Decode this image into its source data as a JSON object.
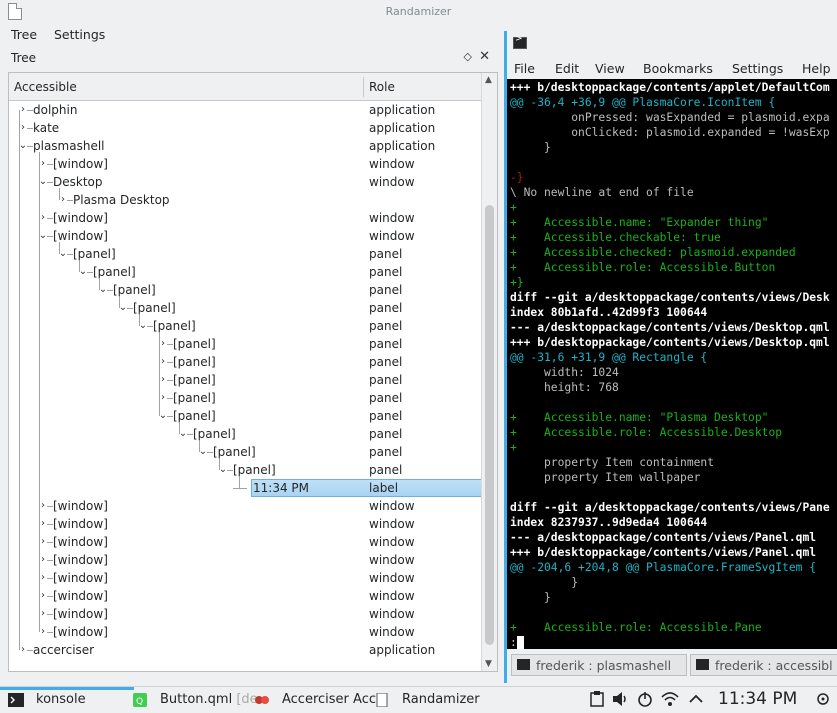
{
  "window": {
    "title": "Randamizer"
  },
  "menu": {
    "tree": "Tree",
    "settings": "Settings"
  },
  "dock": {
    "title": "Tree",
    "float_glyph": "◇",
    "close_glyph": "✕"
  },
  "tree": {
    "columns": {
      "accessible": "Accessible",
      "role": "Role"
    },
    "rows": [
      {
        "name": "dolphin",
        "role": "application",
        "depth": 0,
        "exp": "closed"
      },
      {
        "name": "kate",
        "role": "application",
        "depth": 0,
        "exp": "closed"
      },
      {
        "name": "plasmashell",
        "role": "application",
        "depth": 0,
        "exp": "open"
      },
      {
        "name": "[window]",
        "role": "window",
        "depth": 1,
        "exp": "closed"
      },
      {
        "name": "Desktop",
        "role": "window",
        "depth": 1,
        "exp": "open"
      },
      {
        "name": "Plasma Desktop",
        "role": "",
        "depth": 2,
        "exp": "closed"
      },
      {
        "name": "[window]",
        "role": "window",
        "depth": 1,
        "exp": "closed"
      },
      {
        "name": "[window]",
        "role": "window",
        "depth": 1,
        "exp": "open"
      },
      {
        "name": "[panel]",
        "role": "panel",
        "depth": 2,
        "exp": "open"
      },
      {
        "name": "[panel]",
        "role": "panel",
        "depth": 3,
        "exp": "open"
      },
      {
        "name": "[panel]",
        "role": "panel",
        "depth": 4,
        "exp": "open"
      },
      {
        "name": "[panel]",
        "role": "panel",
        "depth": 5,
        "exp": "open"
      },
      {
        "name": "[panel]",
        "role": "panel",
        "depth": 6,
        "exp": "open"
      },
      {
        "name": "[panel]",
        "role": "panel",
        "depth": 7,
        "exp": "closed"
      },
      {
        "name": "[panel]",
        "role": "panel",
        "depth": 7,
        "exp": "closed"
      },
      {
        "name": "[panel]",
        "role": "panel",
        "depth": 7,
        "exp": "closed"
      },
      {
        "name": "[panel]",
        "role": "panel",
        "depth": 7,
        "exp": "closed"
      },
      {
        "name": "[panel]",
        "role": "panel",
        "depth": 7,
        "exp": "open"
      },
      {
        "name": "[panel]",
        "role": "panel",
        "depth": 8,
        "exp": "open"
      },
      {
        "name": "[panel]",
        "role": "panel",
        "depth": 9,
        "exp": "open"
      },
      {
        "name": "[panel]",
        "role": "panel",
        "depth": 10,
        "exp": "open"
      },
      {
        "name": "11:34 PM",
        "role": "label",
        "depth": 11,
        "exp": "none",
        "selected": true
      },
      {
        "name": "[window]",
        "role": "window",
        "depth": 1,
        "exp": "closed"
      },
      {
        "name": "[window]",
        "role": "window",
        "depth": 1,
        "exp": "closed"
      },
      {
        "name": "[window]",
        "role": "window",
        "depth": 1,
        "exp": "closed"
      },
      {
        "name": "[window]",
        "role": "window",
        "depth": 1,
        "exp": "closed"
      },
      {
        "name": "[window]",
        "role": "window",
        "depth": 1,
        "exp": "closed"
      },
      {
        "name": "[window]",
        "role": "window",
        "depth": 1,
        "exp": "closed"
      },
      {
        "name": "[window]",
        "role": "window",
        "depth": 1,
        "exp": "closed"
      },
      {
        "name": "[window]",
        "role": "window",
        "depth": 1,
        "exp": "closed"
      },
      {
        "name": "accerciser",
        "role": "application",
        "depth": 0,
        "exp": "closed"
      }
    ]
  },
  "konsole": {
    "menu": [
      "File",
      "Edit",
      "View",
      "Bookmarks",
      "Settings",
      "Help"
    ],
    "lines": [
      {
        "t": "+++ b/desktoppackage/contents/applet/DefaultCom",
        "s": "w"
      },
      {
        "t": "@@ -36,4 +36,9 @@ PlasmaCore.IconItem {",
        "s": "c"
      },
      {
        "t": "         onPressed: wasExpanded = plasmoid.expa",
        "s": "n"
      },
      {
        "t": "         onClicked: plasmoid.expanded = !wasExp",
        "s": "n"
      },
      {
        "t": "     }",
        "s": "n"
      },
      {
        "t": "",
        "s": "n"
      },
      {
        "t": "-}",
        "s": "r"
      },
      {
        "t": "\\ No newline at end of file",
        "s": "n"
      },
      {
        "t": "+",
        "s": "g"
      },
      {
        "t": "+    Accessible.name: \"Expander thing\"",
        "s": "g"
      },
      {
        "t": "+    Accessible.checkable: true",
        "s": "g"
      },
      {
        "t": "+    Accessible.checked: plasmoid.expanded",
        "s": "g"
      },
      {
        "t": "+    Accessible.role: Accessible.Button",
        "s": "g"
      },
      {
        "t": "+}",
        "s": "g"
      },
      {
        "t": "diff --git a/desktoppackage/contents/views/Desk",
        "s": "w"
      },
      {
        "t": "index 80b1afd..42d99f3 100644",
        "s": "w"
      },
      {
        "t": "--- a/desktoppackage/contents/views/Desktop.qml",
        "s": "w"
      },
      {
        "t": "+++ b/desktoppackage/contents/views/Desktop.qml",
        "s": "w"
      },
      {
        "t": "@@ -31,6 +31,9 @@ Rectangle {",
        "s": "c"
      },
      {
        "t": "     width: 1024",
        "s": "n"
      },
      {
        "t": "     height: 768",
        "s": "n"
      },
      {
        "t": "",
        "s": "n"
      },
      {
        "t": "+    Accessible.name: \"Plasma Desktop\"",
        "s": "g"
      },
      {
        "t": "+    Accessible.role: Accessible.Desktop",
        "s": "g"
      },
      {
        "t": "+",
        "s": "g"
      },
      {
        "t": "     property Item containment",
        "s": "n"
      },
      {
        "t": "     property Item wallpaper",
        "s": "n"
      },
      {
        "t": "",
        "s": "n"
      },
      {
        "t": "diff --git a/desktoppackage/contents/views/Pane",
        "s": "w"
      },
      {
        "t": "index 8237937..9d9eda4 100644",
        "s": "w"
      },
      {
        "t": "--- a/desktoppackage/contents/views/Panel.qml",
        "s": "w"
      },
      {
        "t": "+++ b/desktoppackage/contents/views/Panel.qml",
        "s": "w"
      },
      {
        "t": "@@ -204,6 +204,8 @@ PlasmaCore.FrameSvgItem {",
        "s": "c"
      },
      {
        "t": "         }",
        "s": "n"
      },
      {
        "t": "     }",
        "s": "n"
      },
      {
        "t": "",
        "s": "n"
      },
      {
        "t": "+    Accessible.role: Accessible.Pane",
        "s": "g"
      },
      {
        "t": ":",
        "s": "n"
      }
    ],
    "tabs": [
      "frederik : plasmashell",
      "frederik : accessibl"
    ]
  },
  "taskbar": {
    "tasks": [
      {
        "label": "konsole",
        "sub": "",
        "icon": "terminal-icon",
        "active": true
      },
      {
        "label": "Button.qml",
        "sub": " [de",
        "icon": "qt-creator-icon",
        "active": false
      },
      {
        "label": "Accerciser Acc",
        "sub": "",
        "icon": "accerciser-icon",
        "active": false
      },
      {
        "label": "Randamizer",
        "sub": "",
        "icon": "randamizer-icon",
        "active": false
      }
    ],
    "clock": "11:34 PM"
  }
}
